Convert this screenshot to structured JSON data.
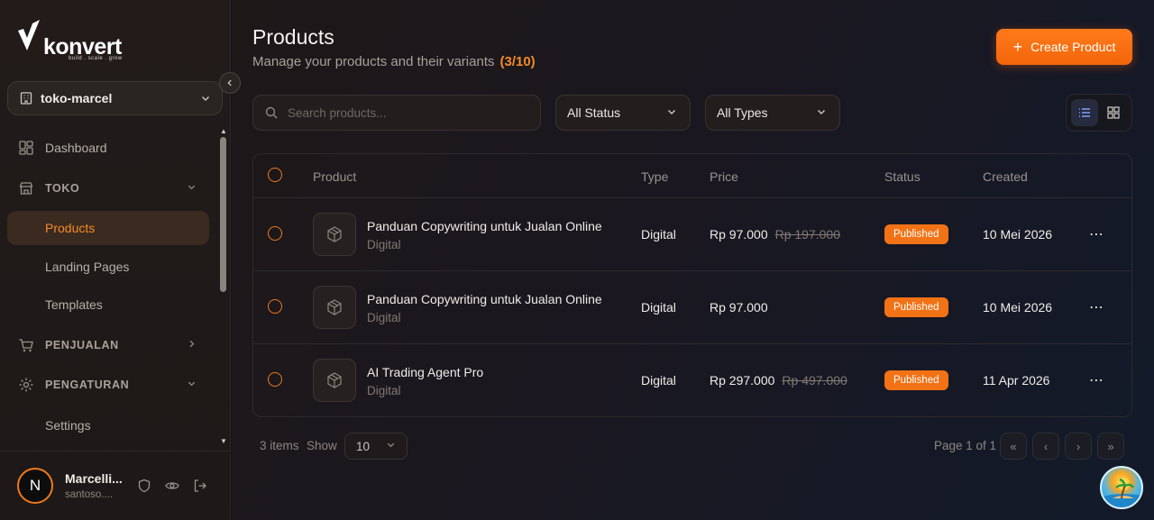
{
  "brand": {
    "name": "konvert",
    "tagline": "build . scale . grow"
  },
  "store": {
    "name": "toko-marcel"
  },
  "sidebar": {
    "items": [
      {
        "label": "Dashboard"
      },
      {
        "label": "TOKO"
      },
      {
        "label": "Products"
      },
      {
        "label": "Landing Pages"
      },
      {
        "label": "Templates"
      },
      {
        "label": "PENJUALAN"
      },
      {
        "label": "PENGATURAN"
      },
      {
        "label": "Settings"
      }
    ]
  },
  "user": {
    "name": "Marcelli...",
    "email": "santoso....",
    "initial": "N"
  },
  "header": {
    "title": "Products",
    "subtitle": "Manage your products and their variants",
    "count": "(3/10)",
    "create_label": "Create Product"
  },
  "search": {
    "placeholder": "Search products..."
  },
  "filters": {
    "status": "All Status",
    "type": "All Types"
  },
  "table": {
    "columns": [
      "Product",
      "Type",
      "Price",
      "Status",
      "Created"
    ],
    "rows": [
      {
        "name": "Panduan Copywriting untuk Jualan Online",
        "subtype": "Digital",
        "type": "Digital",
        "price": "Rp 97.000",
        "old_price": "Rp 197.000",
        "status": "Published",
        "created": "10 Mei 2026"
      },
      {
        "name": "Panduan Copywriting untuk Jualan Online",
        "subtype": "Digital",
        "type": "Digital",
        "price": "Rp 97.000",
        "old_price": "",
        "status": "Published",
        "created": "10 Mei 2026"
      },
      {
        "name": "AI Trading Agent Pro",
        "subtype": "Digital",
        "type": "Digital",
        "price": "Rp 297.000",
        "old_price": "Rp 497.000",
        "status": "Published",
        "created": "11 Apr 2026"
      }
    ]
  },
  "footer": {
    "items": "3 items",
    "show_label": "Show",
    "page_size": "10",
    "page_info": "Page 1 of 1"
  },
  "colors": {
    "accent": "#f27216",
    "background": "#15131a"
  }
}
